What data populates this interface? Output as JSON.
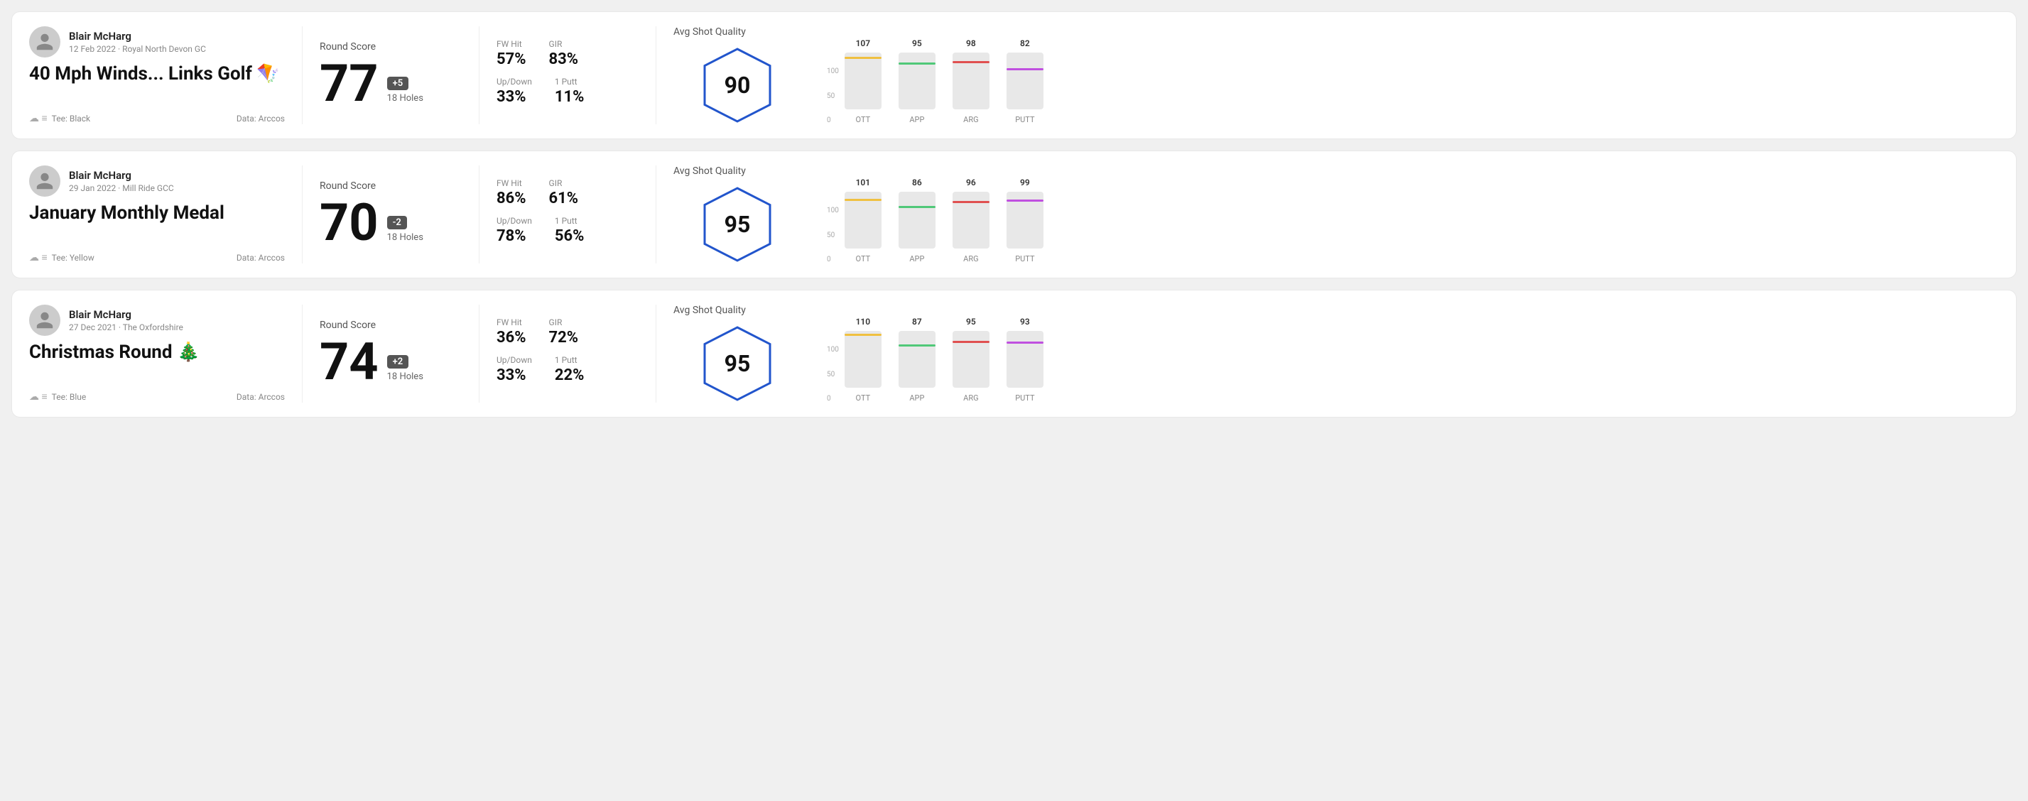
{
  "cards": [
    {
      "id": "card-1",
      "user": {
        "name": "Blair McHarg",
        "date_course": "12 Feb 2022 · Royal North Devon GC"
      },
      "title": "40 Mph Winds... Links Golf 🪁",
      "tee": "Black",
      "data_source": "Data: Arccos",
      "score": {
        "number": "77",
        "badge": "+5",
        "holes": "18 Holes"
      },
      "stats": {
        "fw_hit": "57%",
        "gir": "83%",
        "up_down": "33%",
        "one_putt": "11%"
      },
      "quality": {
        "label": "Avg Shot Quality",
        "score": "90"
      },
      "chart": {
        "bars": [
          {
            "label": "OTT",
            "value": 107,
            "color": "#f0c040"
          },
          {
            "label": "APP",
            "value": 95,
            "color": "#50c878"
          },
          {
            "label": "ARG",
            "value": 98,
            "color": "#e05050"
          },
          {
            "label": "PUTT",
            "value": 82,
            "color": "#c050e0"
          }
        ],
        "max": 120
      }
    },
    {
      "id": "card-2",
      "user": {
        "name": "Blair McHarg",
        "date_course": "29 Jan 2022 · Mill Ride GCC"
      },
      "title": "January Monthly Medal",
      "tee": "Yellow",
      "data_source": "Data: Arccos",
      "score": {
        "number": "70",
        "badge": "-2",
        "holes": "18 Holes"
      },
      "stats": {
        "fw_hit": "86%",
        "gir": "61%",
        "up_down": "78%",
        "one_putt": "56%"
      },
      "quality": {
        "label": "Avg Shot Quality",
        "score": "95"
      },
      "chart": {
        "bars": [
          {
            "label": "OTT",
            "value": 101,
            "color": "#f0c040"
          },
          {
            "label": "APP",
            "value": 86,
            "color": "#50c878"
          },
          {
            "label": "ARG",
            "value": 96,
            "color": "#e05050"
          },
          {
            "label": "PUTT",
            "value": 99,
            "color": "#c050e0"
          }
        ],
        "max": 120
      }
    },
    {
      "id": "card-3",
      "user": {
        "name": "Blair McHarg",
        "date_course": "27 Dec 2021 · The Oxfordshire"
      },
      "title": "Christmas Round 🎄",
      "tee": "Blue",
      "data_source": "Data: Arccos",
      "score": {
        "number": "74",
        "badge": "+2",
        "holes": "18 Holes"
      },
      "stats": {
        "fw_hit": "36%",
        "gir": "72%",
        "up_down": "33%",
        "one_putt": "22%"
      },
      "quality": {
        "label": "Avg Shot Quality",
        "score": "95"
      },
      "chart": {
        "bars": [
          {
            "label": "OTT",
            "value": 110,
            "color": "#f0c040"
          },
          {
            "label": "APP",
            "value": 87,
            "color": "#50c878"
          },
          {
            "label": "ARG",
            "value": 95,
            "color": "#e05050"
          },
          {
            "label": "PUTT",
            "value": 93,
            "color": "#c050e0"
          }
        ],
        "max": 120
      }
    }
  ],
  "labels": {
    "round_score": "Round Score",
    "avg_shot_quality": "Avg Shot Quality",
    "fw_hit": "FW Hit",
    "gir": "GIR",
    "up_down": "Up/Down",
    "one_putt": "1 Putt",
    "tee_prefix": "Tee:",
    "y_axis": [
      "100",
      "50",
      "0"
    ]
  }
}
